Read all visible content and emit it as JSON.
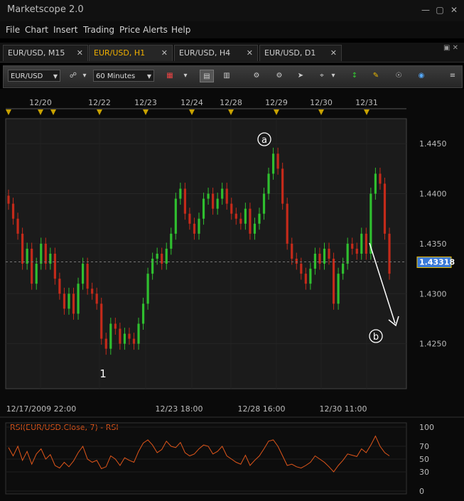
{
  "window": {
    "title": "Marketscope 2.0"
  },
  "menu": [
    "File",
    "Chart",
    "Insert",
    "Trading",
    "Price Alerts",
    "Help"
  ],
  "tabs": [
    "EUR/USD, M15",
    "EUR/USD, H1",
    "EUR/USD, H4",
    "EUR/USD, D1"
  ],
  "active_tab": 1,
  "toolbar": {
    "instrument": "EUR/USD",
    "timeframe": "60 Minutes"
  },
  "colors": {
    "up": "#2fbf2f",
    "down": "#c42a1a",
    "rsi": "#e0561a",
    "marker": "#c8a200",
    "price_badge": "#3a7ad8"
  },
  "chart_data": [
    {
      "type": "candlestick",
      "x_top_labels": [
        "12/20",
        "12/22",
        "12/23",
        "12/24",
        "12/28",
        "12/29",
        "12/30",
        "12/31"
      ],
      "x_bottom_labels": [
        "12/17/2009 22:00",
        "12/23 18:00",
        "12/28 16:00",
        "12/30 11:00"
      ],
      "y_ticks": [
        "1.4450",
        "1.4400",
        "1.4350",
        "1.4300",
        "1.4250"
      ],
      "ylim": [
        1.4205,
        1.4475
      ],
      "current_price": "1.43318",
      "annotations": [
        "1",
        "a",
        "b"
      ],
      "closes": [
        1.439,
        1.4375,
        1.436,
        1.433,
        1.4345,
        1.431,
        1.433,
        1.435,
        1.433,
        1.434,
        1.4315,
        1.43,
        1.4285,
        1.43,
        1.428,
        1.431,
        1.433,
        1.4305,
        1.43,
        1.429,
        1.4255,
        1.4245,
        1.427,
        1.4265,
        1.425,
        1.426,
        1.4255,
        1.425,
        1.427,
        1.429,
        1.432,
        1.4335,
        1.434,
        1.433,
        1.4345,
        1.436,
        1.4395,
        1.4405,
        1.438,
        1.437,
        1.436,
        1.4375,
        1.4395,
        1.44,
        1.4385,
        1.4395,
        1.4405,
        1.439,
        1.438,
        1.4375,
        1.437,
        1.4385,
        1.436,
        1.437,
        1.438,
        1.44,
        1.442,
        1.444,
        1.4425,
        1.439,
        1.435,
        1.4335,
        1.433,
        1.432,
        1.431,
        1.4325,
        1.434,
        1.433,
        1.4345,
        1.4335,
        1.429,
        1.432,
        1.433,
        1.435,
        1.4345,
        1.434,
        1.436,
        1.434,
        1.44,
        1.442,
        1.441,
        1.436,
        1.432
      ]
    },
    {
      "type": "line",
      "title": "RSI(EUR/USD.Close, 7) - RSI",
      "y_ticks": [
        "100",
        "70",
        "50",
        "30",
        "0"
      ],
      "ylim": [
        0,
        100
      ],
      "values": [
        68,
        55,
        70,
        48,
        62,
        42,
        58,
        66,
        50,
        57,
        40,
        36,
        45,
        38,
        47,
        60,
        70,
        50,
        45,
        48,
        35,
        38,
        55,
        50,
        40,
        52,
        48,
        45,
        62,
        75,
        80,
        72,
        60,
        65,
        78,
        70,
        68,
        76,
        60,
        55,
        58,
        66,
        72,
        70,
        58,
        62,
        70,
        55,
        50,
        45,
        42,
        56,
        40,
        48,
        55,
        66,
        78,
        80,
        70,
        55,
        40,
        42,
        38,
        36,
        40,
        45,
        55,
        50,
        45,
        38,
        30,
        40,
        48,
        58,
        56,
        54,
        66,
        60,
        72,
        86,
        70,
        60,
        55
      ]
    }
  ]
}
